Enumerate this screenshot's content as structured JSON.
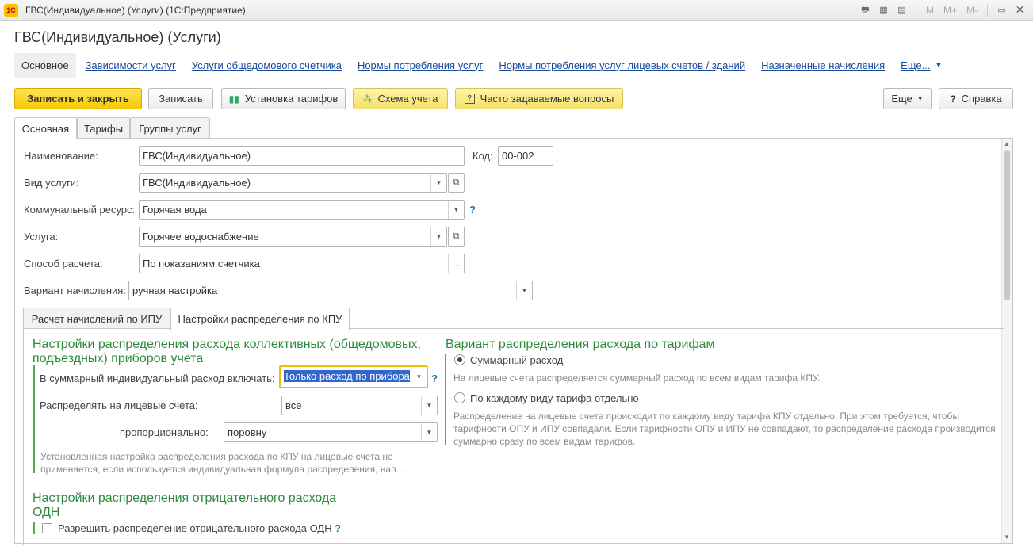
{
  "window": {
    "title": "ГВС(Индивидуальное) (Услуги)  (1С:Предприятие)",
    "logo": "1С",
    "controls": [
      "M",
      "M+",
      "M-"
    ]
  },
  "form": {
    "title": "ГВС(Индивидуальное) (Услуги)"
  },
  "nav": {
    "items": [
      "Основное",
      "Зависимости услуг",
      "Услуги общедомового счетчика",
      "Нормы потребления услуг",
      "Нормы потребления услуг лицевых счетов / зданий",
      "Назначенные начисления",
      "Еще..."
    ]
  },
  "toolbar": {
    "save_close": "Записать и закрыть",
    "save": "Записать",
    "tariffs": "Установка тарифов",
    "scheme": "Схема учета",
    "faq": "Часто задаваемые вопросы",
    "more": "Еще",
    "help": "Справка"
  },
  "tabs": [
    "Основная",
    "Тарифы",
    "Группы услуг"
  ],
  "fields": {
    "name_label": "Наименование:",
    "name_value": "ГВС(Индивидуальное)",
    "code_label": "Код:",
    "code_value": "00-002",
    "service_type_label": "Вид услуги:",
    "service_type_value": "ГВС(Индивидуальное)",
    "resource_label": "Коммунальный ресурс:",
    "resource_value": "Горячая вода",
    "service_label": "Услуга:",
    "service_value": "Горячее водоснабжение",
    "calc_method_label": "Способ расчета:",
    "calc_method_value": "По показаниям счетчика",
    "charge_variant_label": "Вариант начисления:",
    "charge_variant_value": "ручная настройка"
  },
  "subtabs": [
    "Расчет начислений по ИПУ",
    "Настройки распределения по КПУ"
  ],
  "kpu": {
    "group1_title": "Настройки распределения расхода коллективных (общедомовых, подъездных) приборов учета",
    "include_label": "В суммарный индивидуальный расход включать:",
    "include_value": "Только расход по прибора",
    "distribute_label": "Распределять на лицевые счета:",
    "distribute_value": "все",
    "proportional_label": "пропорционально:",
    "proportional_value": "поровну",
    "note1": "Установленная настройка распределения расхода по КПУ на лицевые счета не применяется, если используется индивидуальная формула распределения, нап...",
    "group2_title": "Вариант распределения расхода по тарифам",
    "radio1_label": "Суммарный расход",
    "radio1_note": "На лицевые счета распределяется суммарный расход по всем видам тарифа КПУ.",
    "radio2_label": "По каждому виду тарифа отдельно",
    "radio2_note": "Распределение на лицевые счета происходит по каждому виду тарифа КПУ отдельно. При этом требуется, чтобы тарифности ОПУ и ИПУ совпадали. Если тарифности ОПУ и ИПУ не совпадают, то распределение расхода производится суммарно сразу по всем видам тарифов.",
    "selected_radio": "Суммарный расход",
    "group3_title": "Настройки распределения отрицательного расхода ОДН",
    "allow_negative_label": "Разрешить распределение отрицательного расхода ОДН",
    "allow_negative_checked": false
  },
  "colors": {
    "accent_yellow": "#f5c800",
    "group_green": "#2e8b3e",
    "link_blue": "#1a4a9a"
  }
}
